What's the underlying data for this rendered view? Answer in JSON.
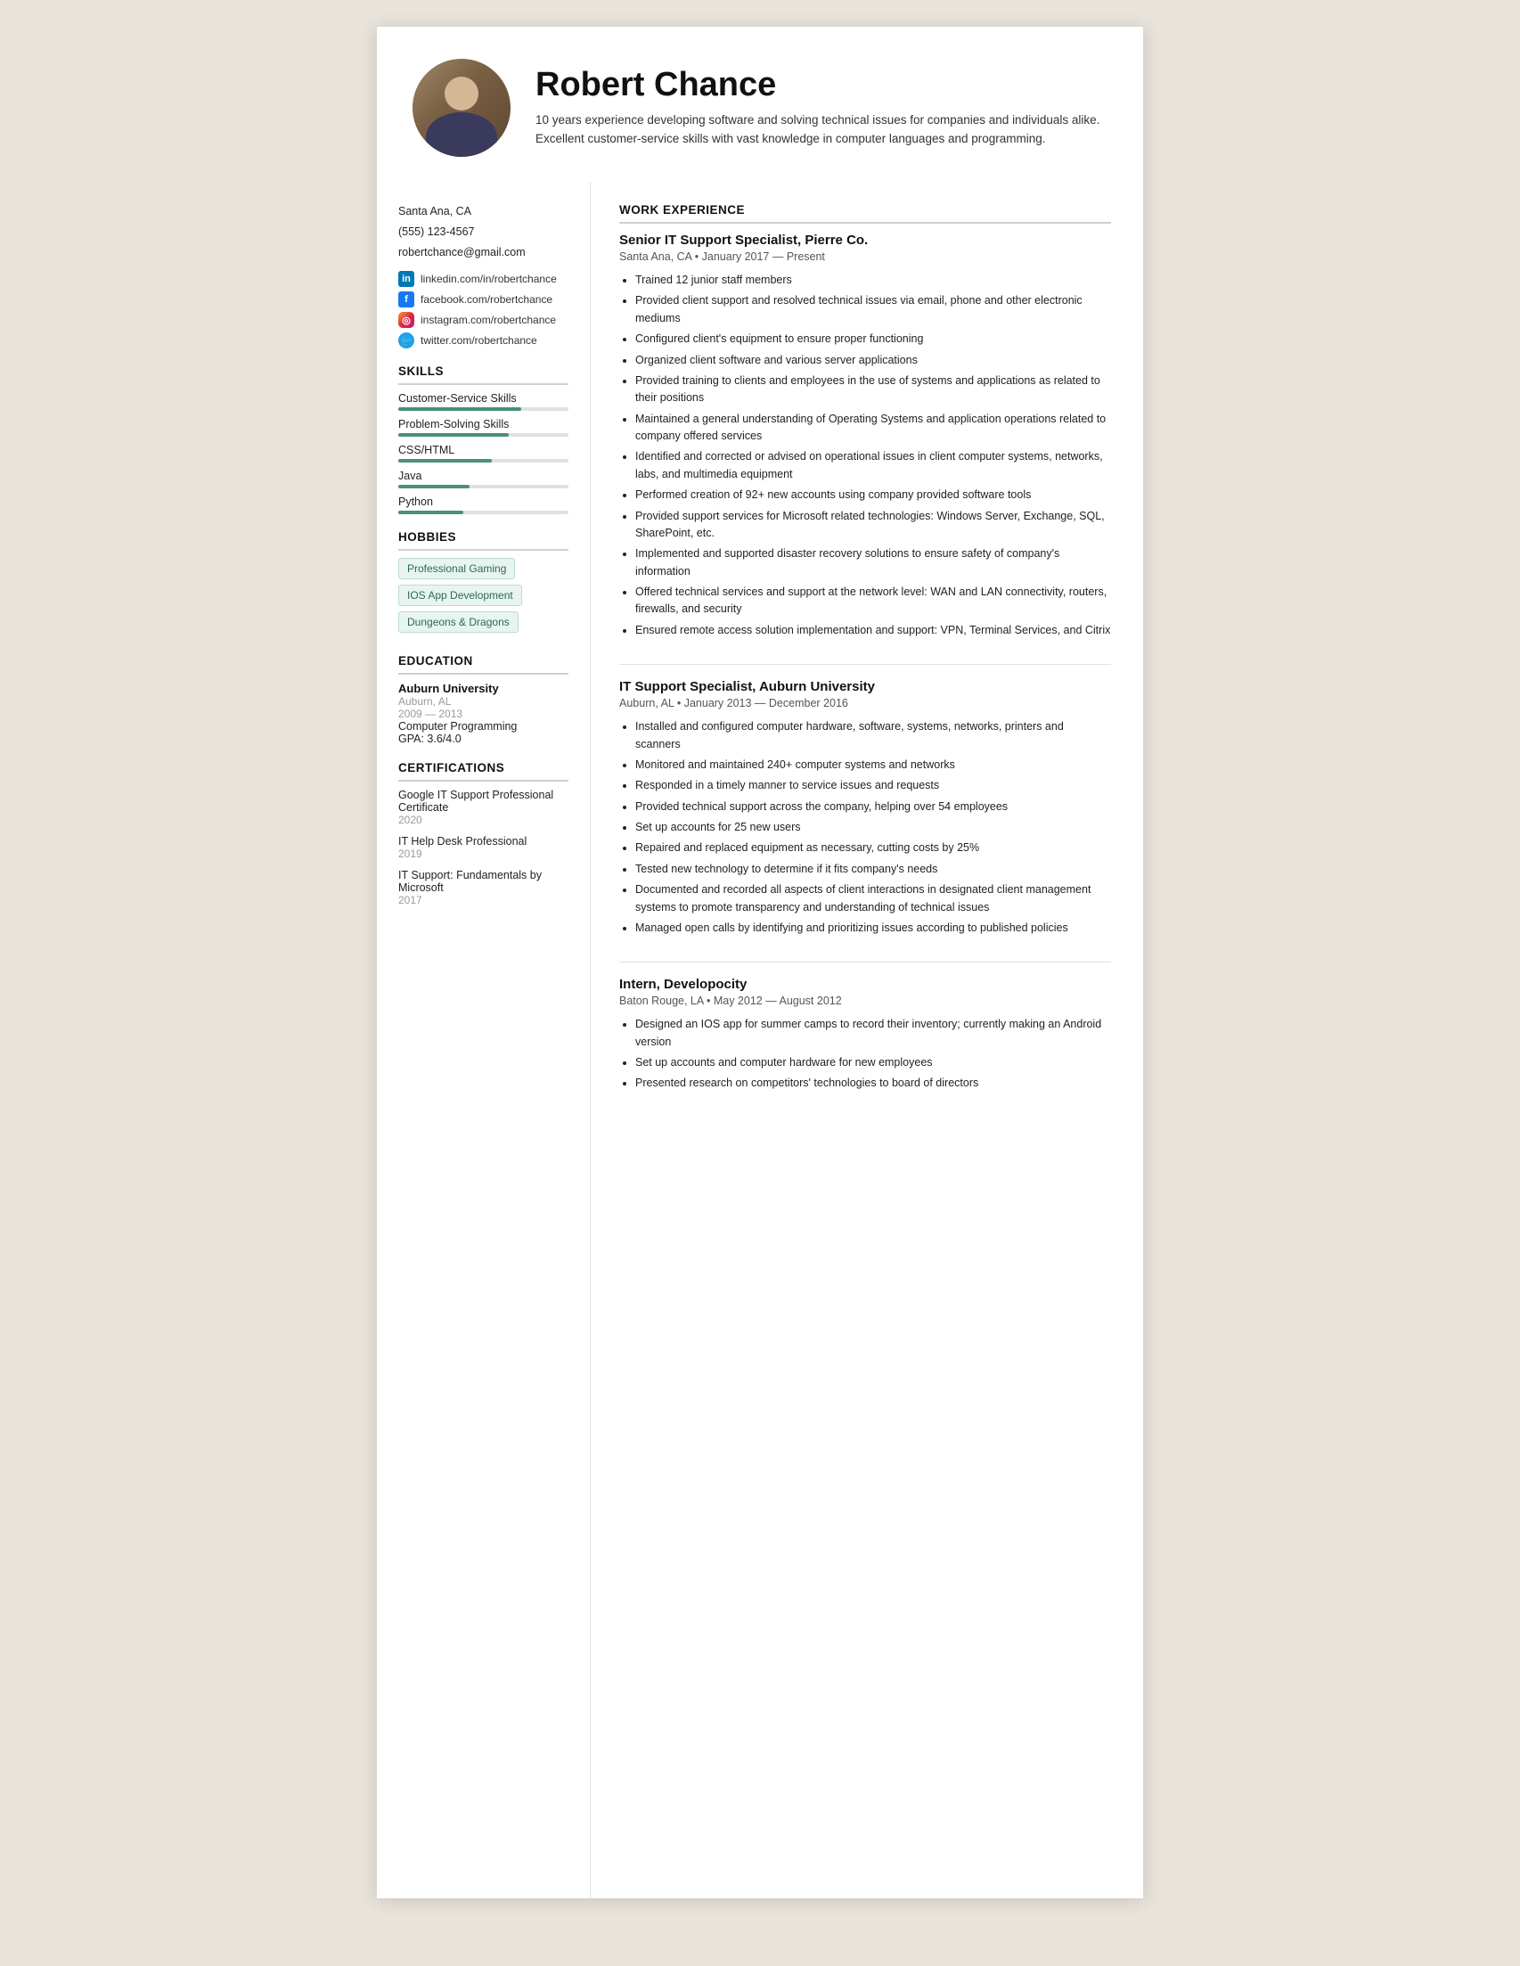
{
  "header": {
    "name": "Robert Chance",
    "summary": "10 years experience developing software and solving technical issues for companies and individuals alike. Excellent customer-service skills with vast knowledge in computer languages and programming.",
    "avatar_alt": "Robert Chance profile photo"
  },
  "sidebar": {
    "contact": {
      "location": "Santa Ana, CA",
      "phone": "(555) 123-4567",
      "email": "robertchance@gmail.com"
    },
    "social": [
      {
        "icon": "linkedin",
        "label": "linkedin.com/in/robertchance"
      },
      {
        "icon": "facebook",
        "label": "facebook.com/robertchance"
      },
      {
        "icon": "instagram",
        "label": "instagram.com/robertchance"
      },
      {
        "icon": "twitter",
        "label": "twitter.com/robertchance"
      }
    ],
    "skills_title": "SKILLS",
    "skills": [
      {
        "name": "Customer-Service Skills",
        "pct": 72
      },
      {
        "name": "Problem-Solving Skills",
        "pct": 65
      },
      {
        "name": "CSS/HTML",
        "pct": 55
      },
      {
        "name": "Java",
        "pct": 42
      },
      {
        "name": "Python",
        "pct": 38
      }
    ],
    "hobbies_title": "HOBBIES",
    "hobbies": [
      "Professional Gaming",
      "IOS App Development",
      "Dungeons & Dragons"
    ],
    "education_title": "EDUCATION",
    "education": [
      {
        "school": "Auburn University",
        "location": "Auburn, AL",
        "dates": "2009 — 2013",
        "field": "Computer Programming",
        "gpa": "GPA: 3.6/4.0"
      }
    ],
    "certifications_title": "CERTIFICATIONS",
    "certifications": [
      {
        "name": "Google IT Support Professional Certificate",
        "year": "2020"
      },
      {
        "name": "IT Help Desk Professional",
        "year": "2019"
      },
      {
        "name": "IT Support: Fundamentals by Microsoft",
        "year": "2017"
      }
    ]
  },
  "main": {
    "work_title": "WORK EXPERIENCE",
    "jobs": [
      {
        "title": "Senior IT Support Specialist, Pierre Co.",
        "meta": "Santa Ana, CA • January 2017 — Present",
        "bullets": [
          "Trained 12 junior staff members",
          "Provided client support and resolved technical issues via email, phone and other electronic mediums",
          "Configured client's equipment to ensure proper functioning",
          "Organized client software and various server applications",
          "Provided training to clients and employees in the use of systems and applications as related to their positions",
          "Maintained a general understanding of Operating Systems and application operations related to company offered services",
          "Identified and corrected or advised on operational issues in client computer systems, networks, labs, and multimedia equipment",
          "Performed creation of 92+ new accounts using company provided software tools",
          "Provided support services for Microsoft related technologies: Windows Server, Exchange, SQL, SharePoint, etc.",
          "Implemented and supported disaster recovery solutions to ensure safety of company's information",
          "Offered technical services and support at the network level: WAN and LAN connectivity, routers, firewalls, and security",
          "Ensured remote access solution implementation and support: VPN, Terminal Services, and Citrix"
        ]
      },
      {
        "title": "IT Support Specialist, Auburn University",
        "meta": "Auburn, AL • January 2013 — December 2016",
        "bullets": [
          "Installed and configured computer hardware, software, systems, networks, printers and scanners",
          "Monitored and maintained 240+ computer systems and networks",
          "Responded in a timely manner to service issues and requests",
          "Provided technical support across the company, helping over 54 employees",
          "Set up accounts for 25 new users",
          "Repaired and replaced equipment as necessary, cutting costs by 25%",
          "Tested new technology to determine if it fits company's needs",
          "Documented and recorded all aspects of client interactions in designated client management systems to promote transparency and understanding of technical issues",
          "Managed open calls by identifying and prioritizing issues according to published policies"
        ]
      },
      {
        "title": "Intern, Developocity",
        "meta": "Baton Rouge, LA • May 2012 — August 2012",
        "bullets": [
          "Designed an IOS app for summer camps to record their inventory; currently making an Android version",
          "Set up accounts and computer hardware for new employees",
          "Presented research on competitors' technologies to board of directors"
        ]
      }
    ]
  }
}
